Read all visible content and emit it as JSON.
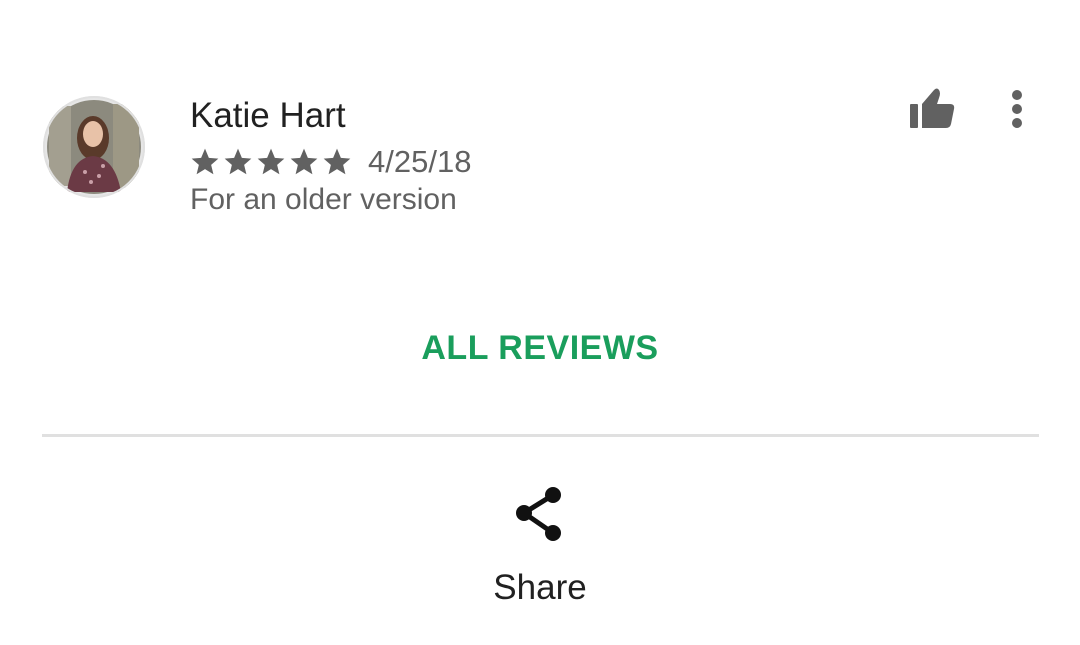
{
  "review": {
    "author": "Katie Hart",
    "rating": 5,
    "rating_max": 5,
    "date": "4/25/18",
    "version_note": "For an older version",
    "avatar_icon": "user-photo-avatar",
    "helpful_icon": "thumbs-up-icon",
    "more_icon": "more-vert-icon"
  },
  "all_reviews_label": "ALL REVIEWS",
  "share": {
    "label": "Share",
    "icon": "share-icon"
  },
  "colors": {
    "accent": "#1a9e5c",
    "star": "#616161",
    "secondary_text": "#616161",
    "divider": "#e0e0e0"
  }
}
